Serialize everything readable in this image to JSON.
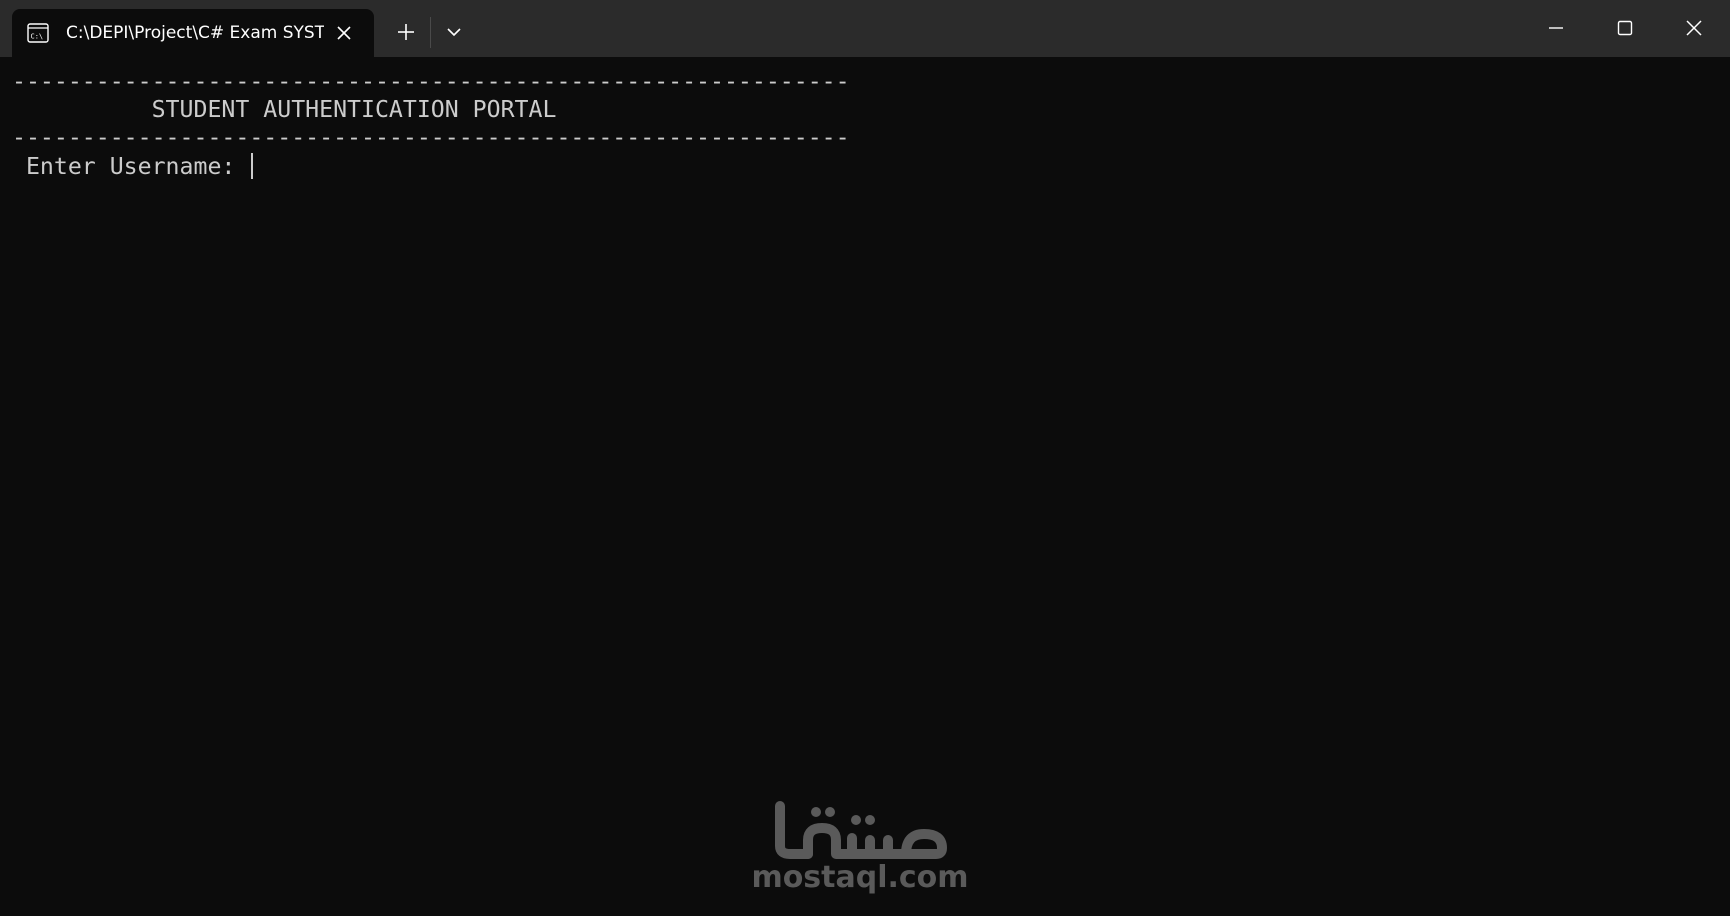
{
  "tab": {
    "title": "C:\\DEPI\\Project\\C# Exam SYSTEM",
    "icon": "console-icon"
  },
  "toolbar": {
    "new_tab_icon": "plus-icon",
    "dropdown_icon": "chevron-down-icon"
  },
  "window_controls": {
    "minimize_icon": "minimize-icon",
    "maximize_icon": "maximize-icon",
    "close_icon": "close-icon"
  },
  "terminal": {
    "lines": [
      "------------------------------------------------------------",
      "          STUDENT AUTHENTICATION PORTAL",
      "------------------------------------------------------------",
      " Enter Username: "
    ],
    "text_color": "#cccccc",
    "background": "#0c0c0c"
  },
  "watermark": {
    "logo_text": "مستقل",
    "domain": "mostaql.com"
  },
  "colors": {
    "titlebar": "#2b2b2b",
    "active_tab": "#0c0c0c",
    "title_text": "#ffffff",
    "watermark": "#5a5a5a"
  }
}
